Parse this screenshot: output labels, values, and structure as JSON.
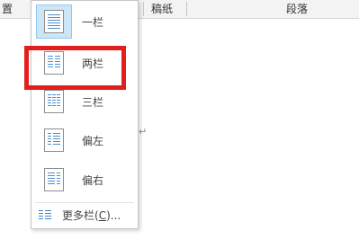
{
  "ribbon": {
    "left_label": "置",
    "middle_label": "稿纸",
    "right_label": "段落"
  },
  "columns_menu": {
    "items": [
      {
        "label": "一栏",
        "icon": "one-column-icon",
        "selected": true
      },
      {
        "label": "两栏",
        "icon": "two-columns-icon",
        "selected": false
      },
      {
        "label": "三栏",
        "icon": "three-columns-icon",
        "selected": false
      },
      {
        "label": "偏左",
        "icon": "left-column-icon",
        "selected": false
      },
      {
        "label": "偏右",
        "icon": "right-column-icon",
        "selected": false
      }
    ],
    "more_label_prefix": "更多栏(",
    "more_label_key": "C",
    "more_label_suffix": ")...",
    "more_icon": "more-columns-icon"
  },
  "document": {
    "paragraph_mark": "↵"
  },
  "colors": {
    "highlight": "#e31e1e",
    "selected_bg": "#cde6f7",
    "icon_line": "#4f8fd0"
  }
}
